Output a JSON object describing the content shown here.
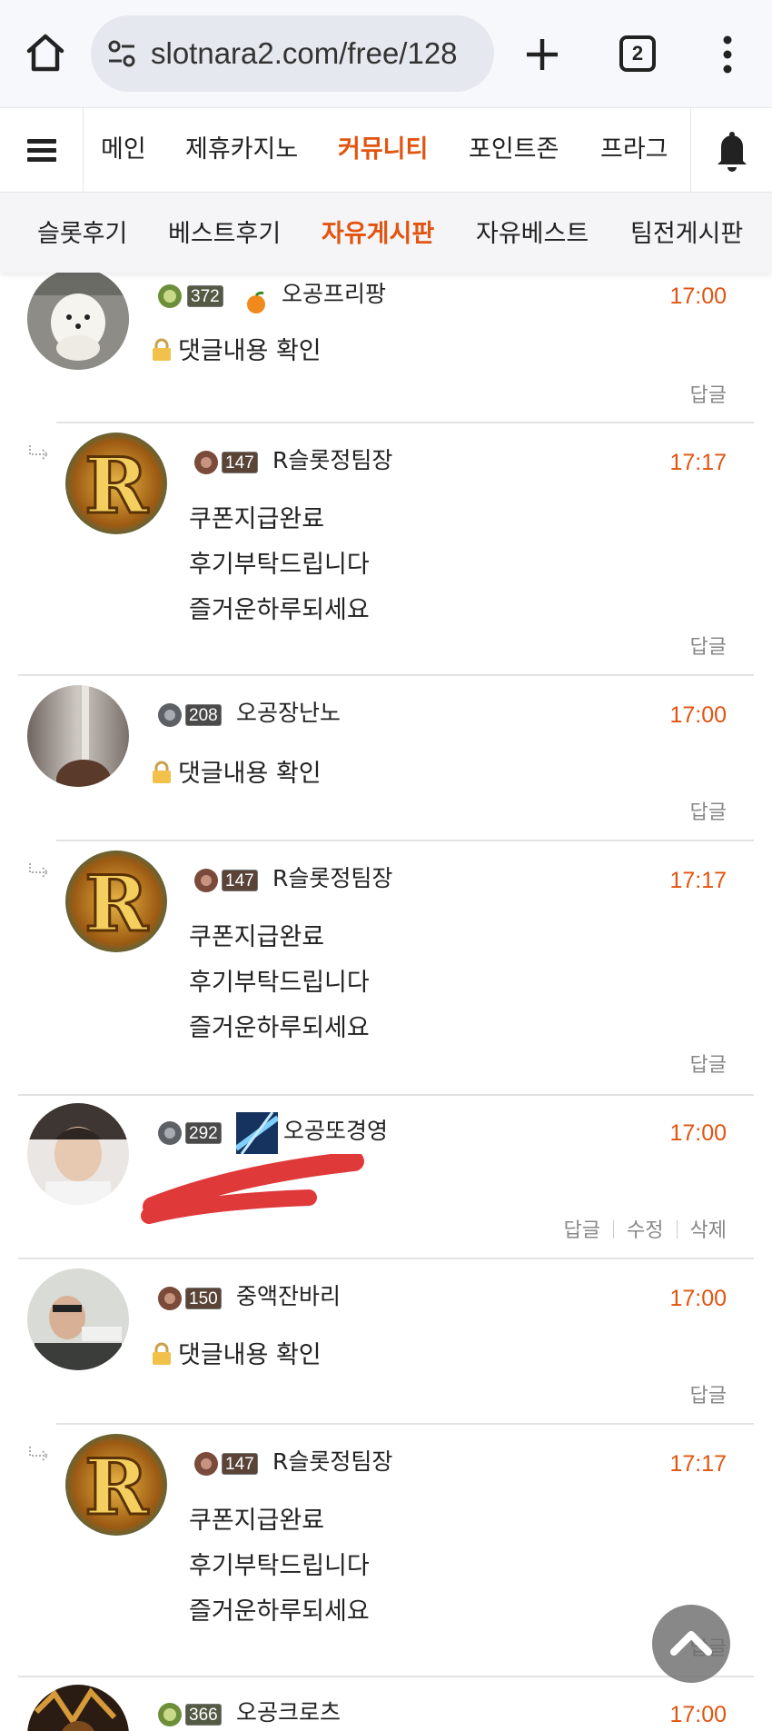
{
  "browser": {
    "url": "slotnara2.com/free/128",
    "tab_count": "2"
  },
  "site_nav": {
    "items": [
      {
        "label": "메인"
      },
      {
        "label": "제휴카지노"
      },
      {
        "label": "커뮤니티",
        "active": true
      },
      {
        "label": "포인트존"
      },
      {
        "label": "프라그"
      }
    ]
  },
  "sub_nav": {
    "items": [
      {
        "label": "슬롯후기"
      },
      {
        "label": "베스트후기"
      },
      {
        "label": "자유게시판",
        "active": true
      },
      {
        "label": "자유베스트"
      },
      {
        "label": "팀전게시판"
      }
    ]
  },
  "comments": [
    {
      "level": "372",
      "nickname": "오공프리팡",
      "time": "17:00",
      "locked_text": "댓글내용 확인",
      "reply_label": "답글"
    },
    {
      "level": "147",
      "nickname": "R슬롯정팀장",
      "time": "17:17",
      "lines": [
        "쿠폰지급완료",
        "후기부탁드립니다",
        "즐거운하루되세요"
      ],
      "reply_label": "답글"
    },
    {
      "level": "208",
      "nickname": "오공장난노",
      "time": "17:00",
      "locked_text": "댓글내용 확인",
      "reply_label": "답글"
    },
    {
      "level": "147",
      "nickname": "R슬롯정팀장",
      "time": "17:17",
      "lines": [
        "쿠폰지급완료",
        "후기부탁드립니다",
        "즐거운하루되세요"
      ],
      "reply_label": "답글"
    },
    {
      "level": "292",
      "nickname": "오공또경영",
      "time": "17:00",
      "reply_label": "답글",
      "edit_label": "수정",
      "delete_label": "삭제"
    },
    {
      "level": "150",
      "nickname": "중액잔바리",
      "time": "17:00",
      "locked_text": "댓글내용 확인",
      "reply_label": "답글"
    },
    {
      "level": "147",
      "nickname": "R슬롯정팀장",
      "time": "17:17",
      "lines": [
        "쿠폰지급완료",
        "후기부탁드립니다",
        "즐거운하루되세요"
      ],
      "reply_label": "답글"
    },
    {
      "level": "366",
      "nickname": "오공크로츠",
      "time": "17:00"
    }
  ],
  "colors": {
    "accent": "#e2540f",
    "muted": "#888888"
  }
}
